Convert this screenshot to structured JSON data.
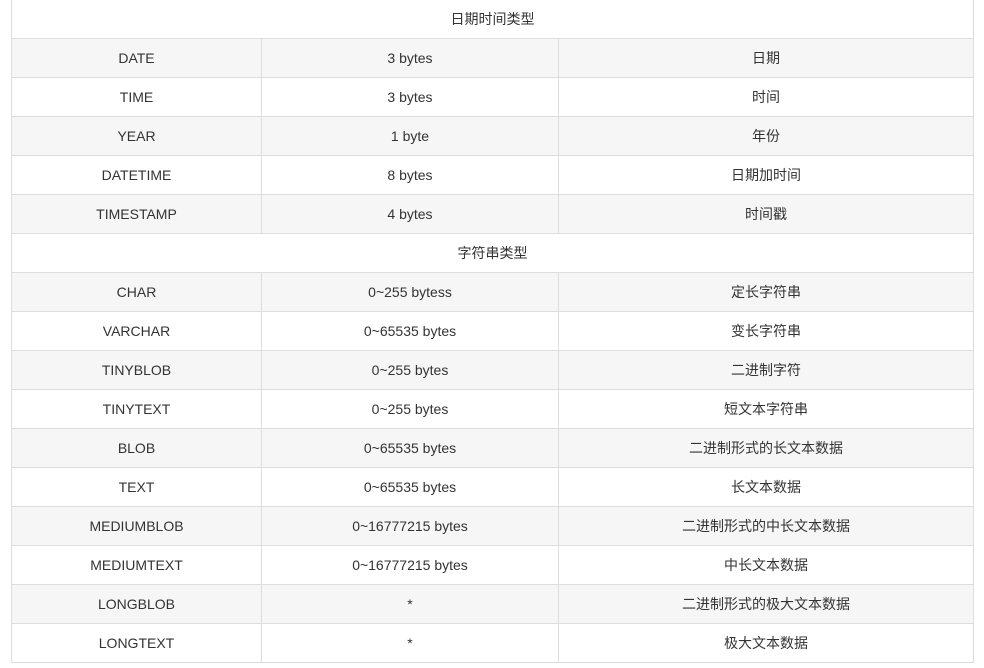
{
  "sections": [
    {
      "title": "日期时间类型",
      "rows": [
        {
          "type": "DATE",
          "size": "3 bytes",
          "desc": "日期"
        },
        {
          "type": "TIME",
          "size": "3 bytes",
          "desc": "时间"
        },
        {
          "type": "YEAR",
          "size": "1 byte",
          "desc": "年份"
        },
        {
          "type": "DATETIME",
          "size": "8 bytes",
          "desc": "日期加时间"
        },
        {
          "type": "TIMESTAMP",
          "size": "4 bytes",
          "desc": "时间戳"
        }
      ]
    },
    {
      "title": "字符串类型",
      "rows": [
        {
          "type": "CHAR",
          "size": "0~255 bytess",
          "desc": "定长字符串"
        },
        {
          "type": "VARCHAR",
          "size": "0~65535 bytes",
          "desc": "变长字符串"
        },
        {
          "type": "TINYBLOB",
          "size": "0~255 bytes",
          "desc": "二进制字符"
        },
        {
          "type": "TINYTEXT",
          "size": "0~255 bytes",
          "desc": "短文本字符串"
        },
        {
          "type": "BLOB",
          "size": "0~65535 bytes",
          "desc": "二进制形式的长文本数据"
        },
        {
          "type": "TEXT",
          "size": "0~65535 bytes",
          "desc": "长文本数据"
        },
        {
          "type": "MEDIUMBLOB",
          "size": "0~16777215 bytes",
          "desc": "二进制形式的中长文本数据"
        },
        {
          "type": "MEDIUMTEXT",
          "size": "0~16777215 bytes",
          "desc": "中长文本数据"
        },
        {
          "type": "LONGBLOB",
          "size": "*",
          "desc": "二进制形式的极大文本数据"
        },
        {
          "type": "LONGTEXT",
          "size": "*",
          "desc": "极大文本数据"
        }
      ]
    }
  ]
}
